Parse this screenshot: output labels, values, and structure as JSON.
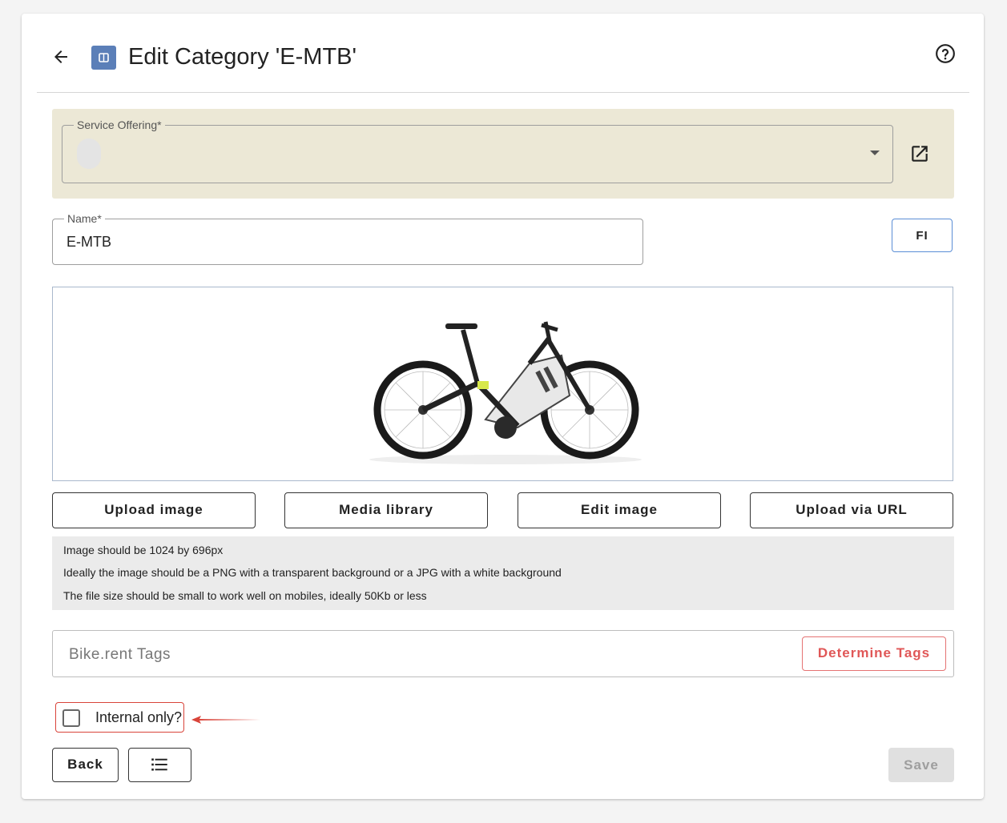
{
  "header": {
    "title": "Edit Category 'E-MTB'"
  },
  "service_offering": {
    "legend": "Service Offering*",
    "value": ""
  },
  "name_field": {
    "legend": "Name*",
    "value": "E-MTB"
  },
  "fi_button": "FI",
  "image_actions": {
    "upload": "Upload image",
    "media_library": "Media library",
    "edit": "Edit image",
    "upload_url": "Upload via URL"
  },
  "image_info": [
    "Image should be 1024 by 696px",
    "Ideally the image should be a PNG with a transparent background or a JPG with a white background",
    "The file size should be small to work well on mobiles, ideally 50Kb or less"
  ],
  "tags": {
    "placeholder": "Bike.rent Tags",
    "determine_label": "Determine Tags"
  },
  "internal_only": {
    "label": "Internal only?",
    "checked": false
  },
  "footer": {
    "back_label": "Back",
    "save_label": "Save"
  },
  "icons": {
    "back": "arrow-left-icon",
    "category": "category-icon",
    "help": "help-circle-icon",
    "open_external": "open-in-new-icon",
    "list": "list-icon"
  },
  "colors": {
    "accent_blue": "#5b8ed6",
    "danger_red": "#e05757",
    "service_panel": "#ece8d6"
  }
}
